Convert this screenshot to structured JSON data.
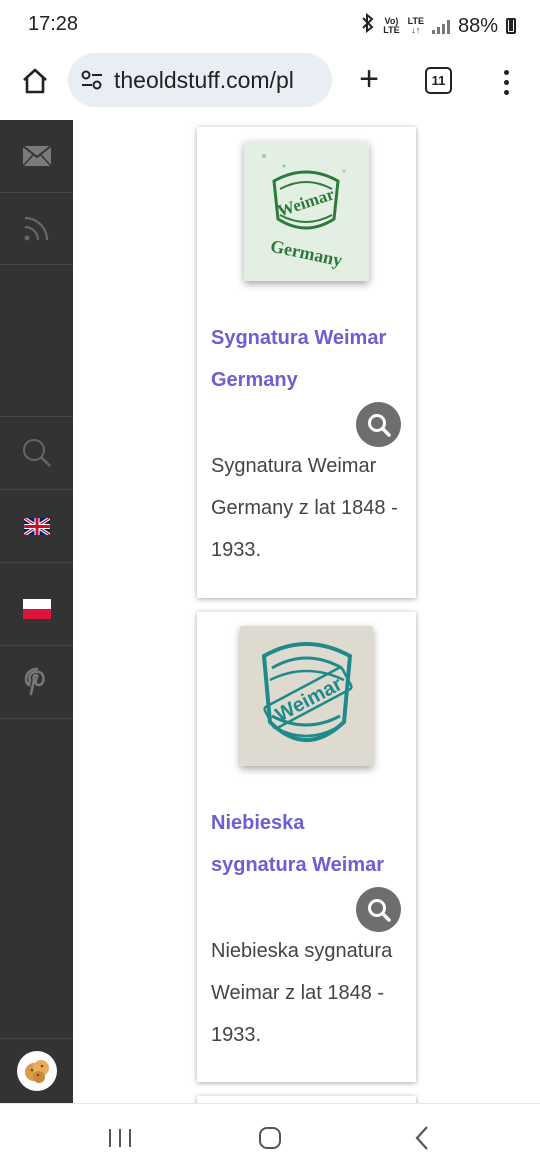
{
  "status": {
    "time": "17:28",
    "bluetooth_icon": "bluetooth-icon",
    "volte_label_top": "Vo)",
    "volte_label_bottom": "LTE",
    "lte_label_top": "LTE",
    "lte_label_bottom": "↓↑",
    "battery": "88%"
  },
  "browser": {
    "url": "theoldstuff.com/pl",
    "tab_count": "11",
    "new_tab_label": "+"
  },
  "sidebar": {
    "items": [
      {
        "icon": "mail-icon"
      },
      {
        "icon": "rss-icon"
      },
      {
        "icon": "search-icon"
      },
      {
        "icon": "uk-flag-icon"
      },
      {
        "icon": "poland-flag-icon"
      },
      {
        "icon": "pinterest-icon"
      },
      {
        "icon": "cookie-icon"
      }
    ]
  },
  "cards": [
    {
      "title": "Sygnatura Weimar Germany",
      "description": "Sygnatura Weimar Germany z lat 1848 - 1933.",
      "thumb_color": "#e4efe4",
      "mark_color": "#2e7a3a",
      "mark_text": "Weimar",
      "mark_subtext": "Germany"
    },
    {
      "title": "Niebieska sygnatura Weimar",
      "description": "Niebieska sygnatura Weimar z lat 1848 - 1933.",
      "thumb_color": "#dedad0",
      "mark_color": "#1f8a8a",
      "mark_text": "Weimar"
    }
  ],
  "colors": {
    "sidebar": "#333333",
    "title_link": "#6c5fd1",
    "zoom_button": "#6e6e6e"
  }
}
